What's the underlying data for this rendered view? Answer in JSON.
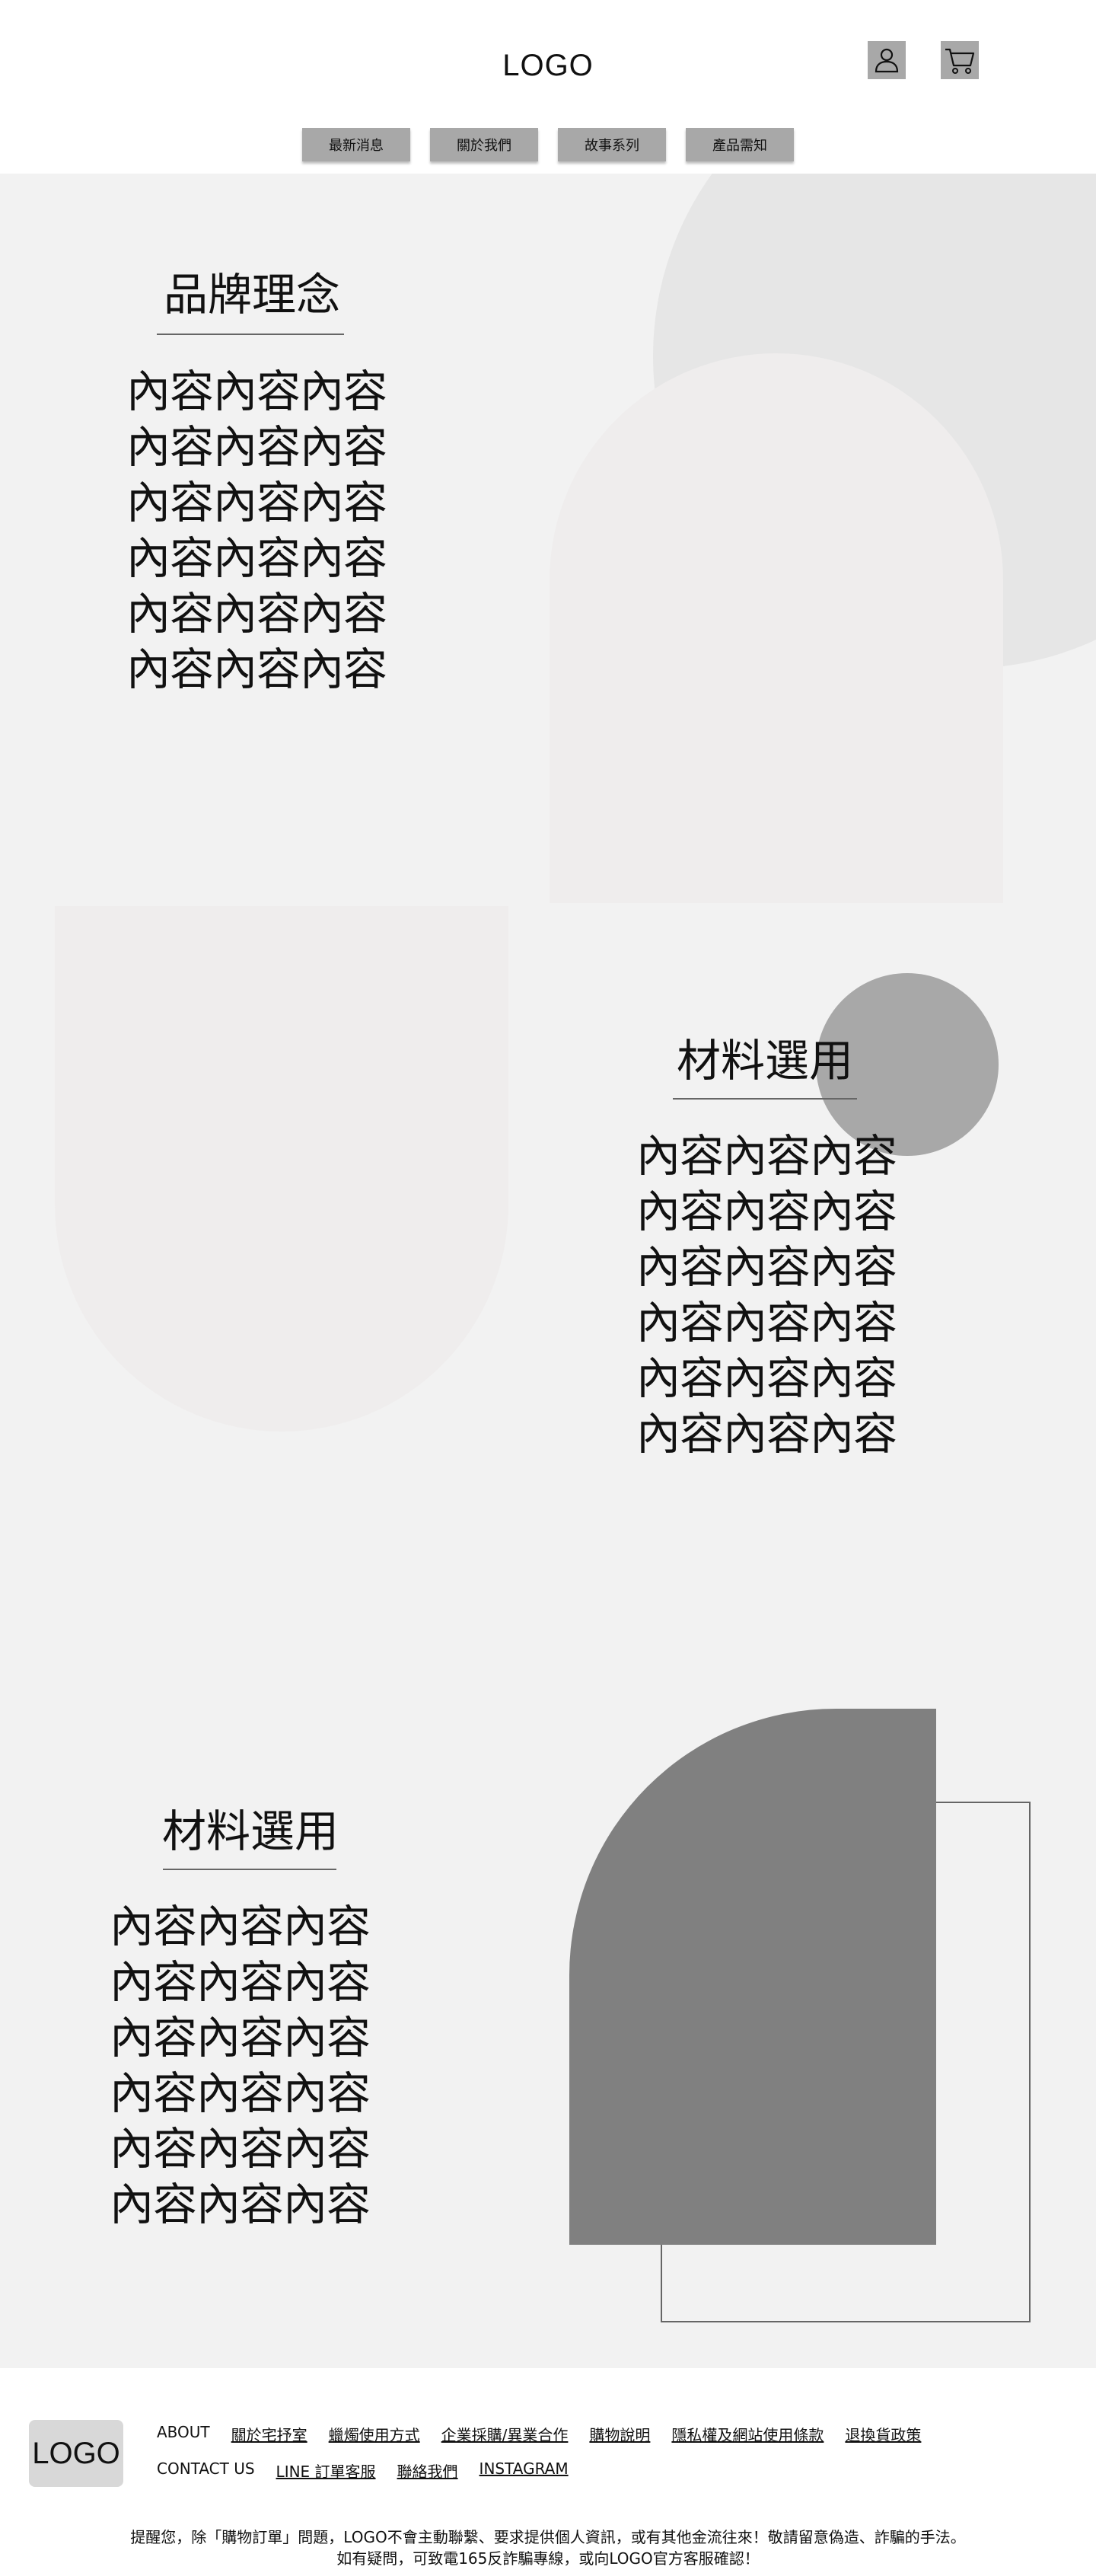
{
  "header": {
    "logo": "LOGO",
    "user_icon": "user-icon",
    "cart_icon": "cart-icon",
    "nav": [
      "最新消息",
      "關於我們",
      "故事系列",
      "產品需知"
    ]
  },
  "sections": [
    {
      "title": "品牌理念",
      "lines": [
        "內容內容內容",
        "內容內容內容",
        "內容內容內容",
        "內容內容內容",
        "內容內容內容",
        "內容內容內容"
      ]
    },
    {
      "title": "材料選用",
      "lines": [
        "內容內容內容",
        "內容內容內容",
        "內容內容內容",
        "內容內容內容",
        "內容內容內容",
        "內容內容內容"
      ]
    },
    {
      "title": "材料選用",
      "lines": [
        "內容內容內容",
        "內容內容內容",
        "內容內容內容",
        "內容內容內容",
        "內容內容內容",
        "內容內容內容"
      ]
    }
  ],
  "footer": {
    "logo": "LOGO",
    "row1": [
      {
        "label": "ABOUT",
        "underline": false
      },
      {
        "label": "關於宅抒室",
        "underline": true
      },
      {
        "label": "蠟燭使用方式",
        "underline": true
      },
      {
        "label": "企業採購/異業合作",
        "underline": true
      },
      {
        "label": "購物說明",
        "underline": true
      },
      {
        "label": "隱私權及網站使用條款",
        "underline": true
      },
      {
        "label": "退換貨政策",
        "underline": true
      }
    ],
    "row2": [
      {
        "label": "CONTACT US",
        "underline": false
      },
      {
        "label": "LINE 訂單客服",
        "underline": true
      },
      {
        "label": "聯絡我們",
        "underline": true
      },
      {
        "label": "INSTAGRAM",
        "underline": true
      }
    ],
    "notice_line1": "提醒您，除「購物訂單」問題，LOGO不會主動聯繫、要求提供個人資訊，或有其他金流往來！敬請留意偽造、詐騙的手法。",
    "notice_line2": "如有疑問，可致電165反詐騙專線，或向LOGO官方客服確認！"
  }
}
